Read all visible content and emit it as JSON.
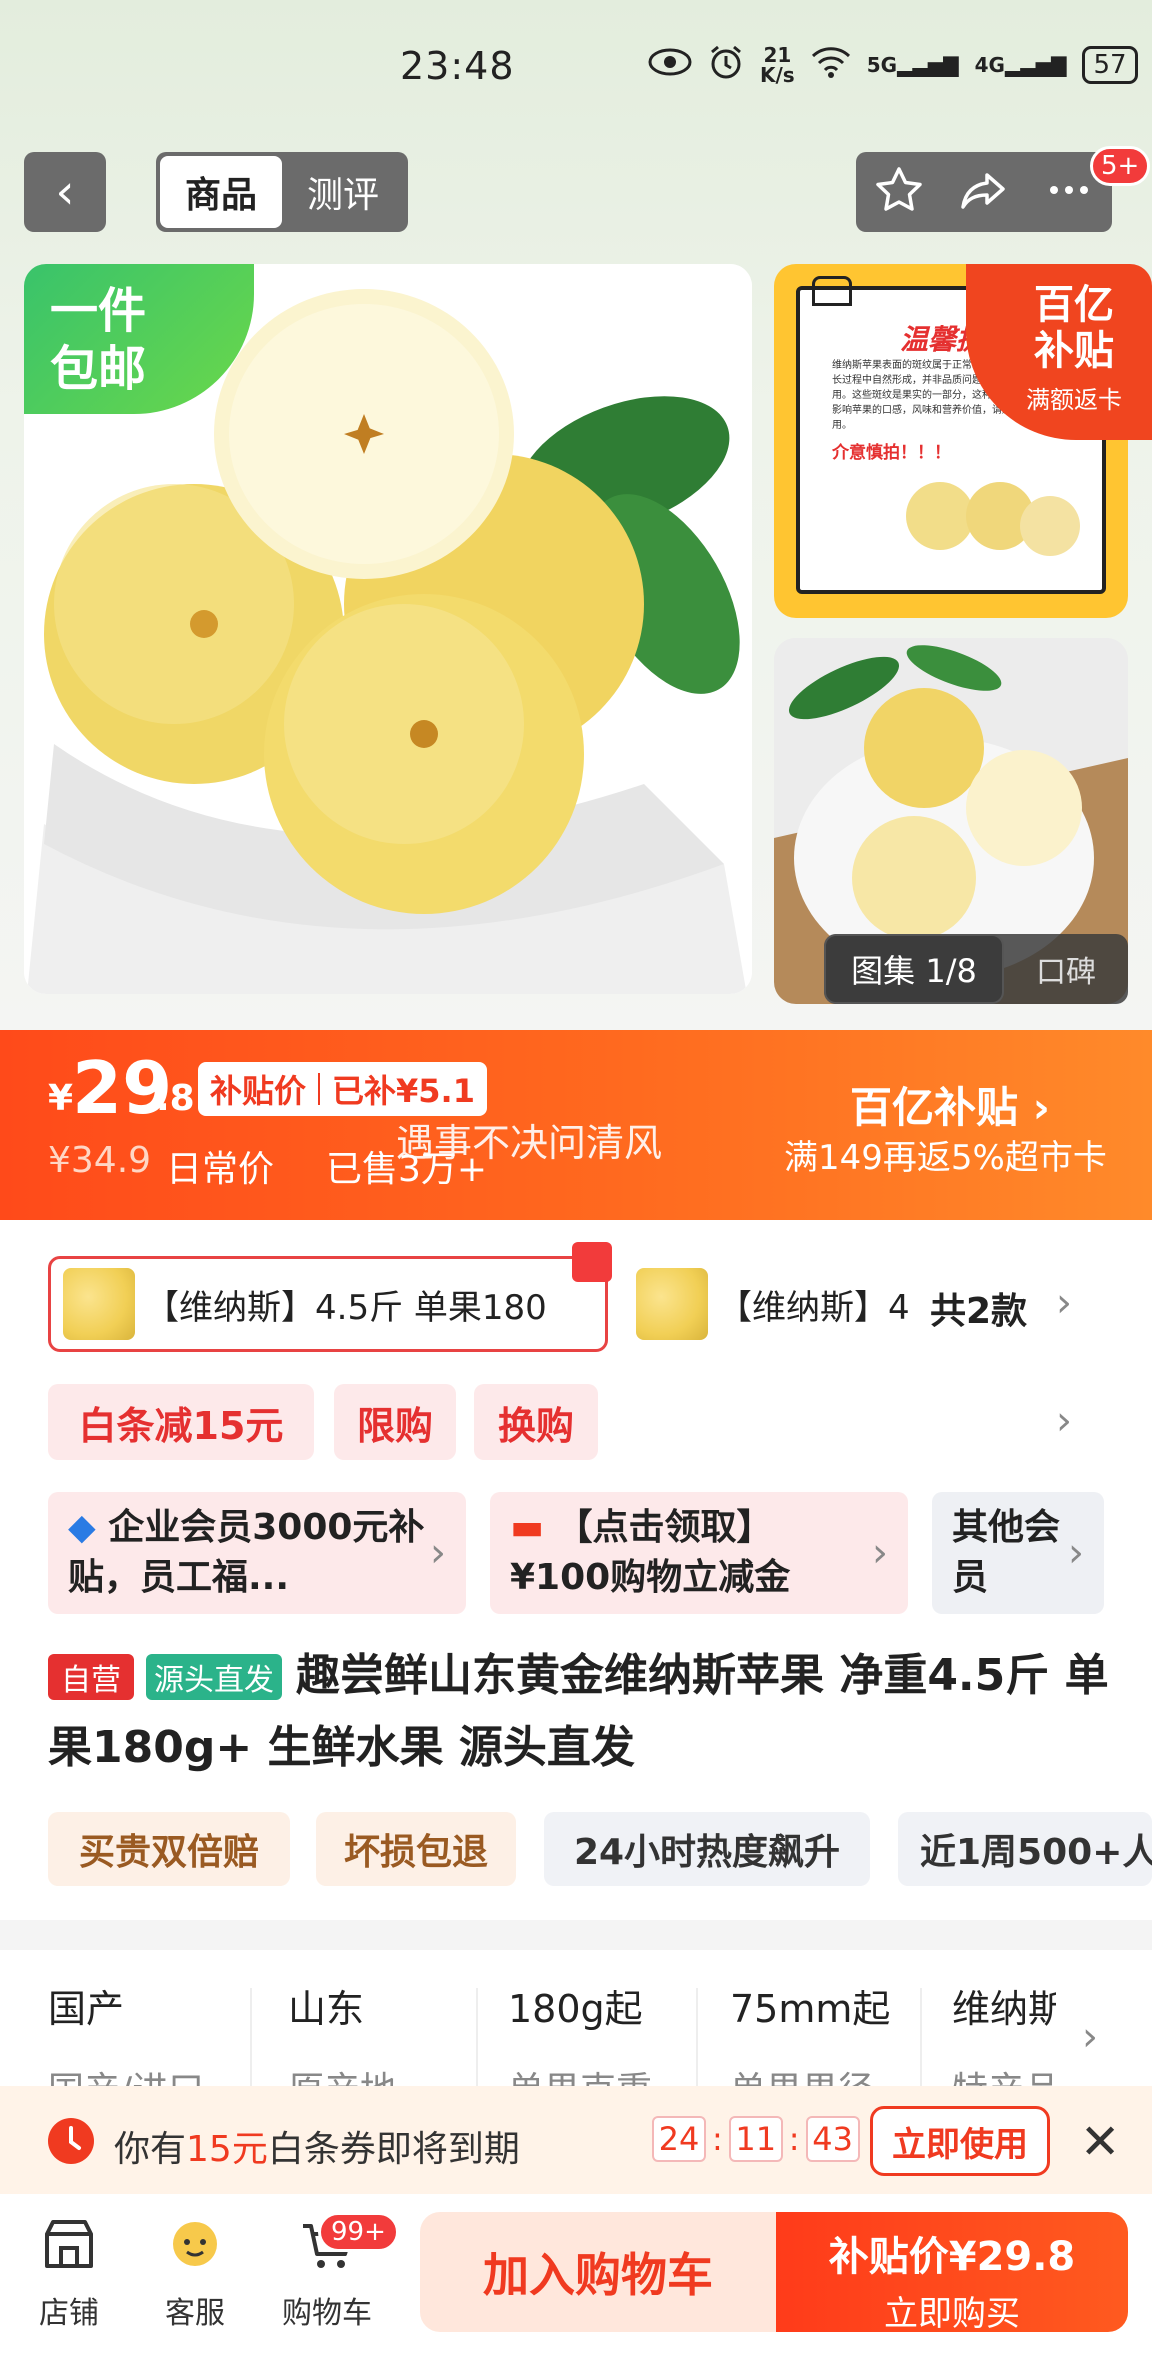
{
  "status_bar": {
    "time": "23:48",
    "net_speed_value": "21",
    "net_speed_unit": "K/s",
    "signal1": "5G",
    "signal2": "4G",
    "battery": "57"
  },
  "nav": {
    "tabs": [
      {
        "label": "商品",
        "active": true
      },
      {
        "label": "测评",
        "active": false
      }
    ],
    "message_badge": "5+"
  },
  "gallery": {
    "free_shipping_line1": "一件",
    "free_shipping_line2": "包邮",
    "subsidy_badge_line1": "百亿",
    "subsidy_badge_line2": "补贴",
    "subsidy_badge_line3": "满额返卡",
    "notice_title": "温馨提示",
    "notice_body": "维纳斯苹果表面的斑纹属于正常现象，是在生长过程中自然形成，并非品质问题，请放心食用。这些斑纹是果实的一部分，这种斑纹不会影响苹果的口感，风味和营养价值，请放心食用。",
    "notice_warn": "介意慎拍！！！",
    "counter": "图集 1/8",
    "reviews_label": "口碑"
  },
  "price": {
    "currency": "¥",
    "integer": "29",
    "decimal": ".8",
    "subsidy_label": "补贴价",
    "subsidy_amount": "已补¥5.1",
    "daily_price": "¥34.9",
    "daily_label": "日常价",
    "sold": "已售3万+",
    "overlay_text": "遇事不决问清风",
    "brand": "百亿补贴 ›",
    "brand_sub": "满149再返5%超市卡"
  },
  "sku": {
    "option1": "【维纳斯】4.5斤 单果180",
    "option2": "【维纳斯】4",
    "count": "共2款"
  },
  "promos": [
    "白条减15元",
    "限购",
    "换购"
  ],
  "members": [
    {
      "text": "企业会员3000元补贴，员工福..."
    },
    {
      "text": "【点击领取】¥100购物立减金"
    },
    {
      "text": "其他会员"
    }
  ],
  "product": {
    "tag_self": "自营",
    "tag_source": "源头直发",
    "title": "趣尝鲜山东黄金维纳斯苹果 净重4.5斤 单果180g+ 生鲜水果 源头直发"
  },
  "service_chips": [
    "买贵双倍赔",
    "坏损包退",
    "24小时热度飙升",
    "近1周500+人"
  ],
  "specs": [
    {
      "value": "国产",
      "key": "国产/进口"
    },
    {
      "value": "山东",
      "key": "原产地"
    },
    {
      "value": "180g起",
      "key": "单果克重"
    },
    {
      "value": "75mm起",
      "key": "单果果径"
    },
    {
      "value": "维纳斯",
      "key": "特产品"
    }
  ],
  "coupon": {
    "prefix": "你有",
    "amount": "15元",
    "suffix": "白条券即将到期",
    "hh": "24",
    "mm": "11",
    "ss": "43",
    "button": "立即使用"
  },
  "bottom_bar": {
    "store": "店铺",
    "service": "客服",
    "cart": "购物车",
    "cart_badge": "99+",
    "add_cart": "加入购物车",
    "buy_line1": "补贴价¥29.8",
    "buy_line2": "立即购买"
  },
  "colors": {
    "accent": "#ff4a1a",
    "price_red": "#f03a20",
    "free_ship_green": "#39c36b"
  }
}
